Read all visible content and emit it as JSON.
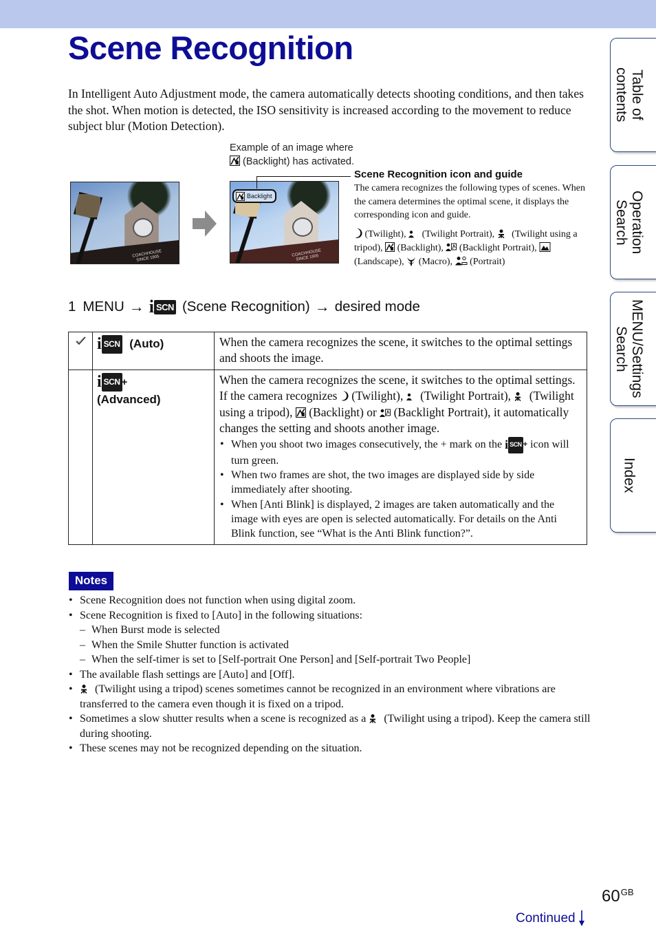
{
  "header": {
    "title": "Scene Recognition",
    "band_color": "#b9c8ec",
    "title_color": "#0d0d96"
  },
  "intro": "In Intelligent Auto Adjustment mode, the camera automatically detects shooting conditions, and then takes the shot. When motion is detected, the ISO sensitivity is increased according to the movement to reduce subject blur (Motion Detection).",
  "example": {
    "caption_line1": "Example of an image where",
    "caption_line2": "(Backlight) has activated.",
    "badge_label": "Backlight",
    "sign_line1": "COACHHOUSE",
    "sign_line2": "SINCE 1905",
    "arrow_icon": "right-arrow-icon"
  },
  "guide": {
    "title": "Scene Recognition icon and guide",
    "text": "The camera recognizes the following types of scenes. When the camera determines the optimal scene, it displays the corresponding icon and guide.",
    "scenes": [
      {
        "icon": "twilight-icon",
        "label": "(Twilight),"
      },
      {
        "icon": "twilight-portrait-icon",
        "label": "(Twilight Portrait),"
      },
      {
        "icon": "twilight-tripod-icon",
        "label": "(Twilight using a tripod),"
      },
      {
        "icon": "backlight-icon",
        "label": "(Backlight),"
      },
      {
        "icon": "backlight-portrait-icon",
        "label": "(Backlight Portrait),"
      },
      {
        "icon": "landscape-icon",
        "label": "(Landscape),"
      },
      {
        "icon": "macro-icon",
        "label": "(Macro),"
      },
      {
        "icon": "portrait-icon",
        "label": "(Portrait)"
      }
    ]
  },
  "step": {
    "number": "1",
    "menu": "MENU",
    "arrow": "→",
    "scn_text": "SCN",
    "middle": "(Scene Recognition)",
    "end": "desired mode"
  },
  "modes": [
    {
      "selected": true,
      "name": "(Auto)",
      "icon_text": "SCN",
      "description": "When the camera recognizes the scene, it switches to the optimal settings and shoots the image."
    },
    {
      "selected": false,
      "name": "(Advanced)",
      "icon_text": "SCN",
      "icon_plus": "+",
      "desc_parts": [
        "When the camera recognizes the scene, it switches to the optimal settings. If the camera recognizes",
        "(Twilight),",
        "(Twilight Portrait),",
        "(Twilight using a tripod),",
        "(Backlight) or",
        "(Backlight Portrait), it automatically changes the setting and shoots another image."
      ],
      "bullets": [
        {
          "before": "When you shoot two images consecutively, the + mark on the",
          "after": "icon will turn green."
        },
        {
          "text": "When two frames are shot, the two images are displayed side by side immediately after shooting."
        },
        {
          "text": "When [Anti Blink] is displayed, 2 images are taken automatically and the image with eyes are open is selected automatically. For details on the Anti Blink function, see “What is the Anti Blink function?”."
        }
      ]
    }
  ],
  "notes": {
    "label": "Notes",
    "items": [
      {
        "text": "Scene Recognition does not function when using digital zoom."
      },
      {
        "text": "Scene Recognition is fixed to [Auto] in the following situations:",
        "sub": [
          "When Burst mode is selected",
          "When the Smile Shutter function is activated",
          "When the self-timer is set to [Self-portrait One Person] and [Self-portrait Two People]"
        ]
      },
      {
        "text": "The available flash settings are [Auto] and [Off]."
      },
      {
        "text": "(Twilight using a tripod) scenes sometimes cannot be recognized in an environment where vibrations are transferred to the camera even though it is fixed on a tripod."
      },
      {
        "text_before": "Sometimes a slow shutter results when a scene is recognized as a",
        "text_after": "(Twilight using a tripod). Keep the camera still during shooting."
      },
      {
        "text": "These scenes may not be recognized depending on the situation."
      }
    ]
  },
  "side_tabs": [
    {
      "label": "Table of\ncontents"
    },
    {
      "label": "Operation\nSearch"
    },
    {
      "label": "MENU/Settings\nSearch"
    },
    {
      "label": "Index"
    }
  ],
  "footer": {
    "page": "60",
    "page_suffix": "GB",
    "continued": "Continued",
    "continued_icon": "down-arrow-icon"
  }
}
